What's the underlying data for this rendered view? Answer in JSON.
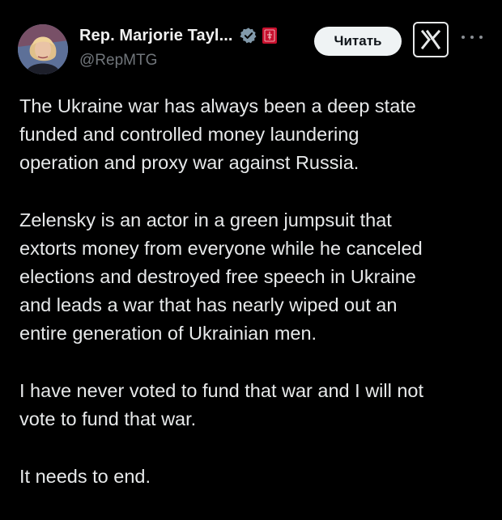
{
  "tweet": {
    "display_name": "Rep. Marjorie Tayl...",
    "handle": "@RepMTG",
    "follow_button_label": "Читать",
    "paragraphs": [
      [
        "The Ukraine war has always been a deep state",
        "funded and controlled money laundering",
        "operation and proxy war against Russia."
      ],
      [
        "Zelensky is an actor in a green jumpsuit that",
        "extorts money from everyone while he canceled",
        "elections and destroyed free speech in Ukraine",
        "and leads a war that has nearly wiped out an",
        "entire generation of Ukrainian men."
      ],
      [
        "I have never voted to fund that war and I will not",
        "vote to fund that war."
      ],
      [
        "It needs to end."
      ]
    ]
  },
  "icons": {
    "verified": "verified-badge-icon",
    "affiliation": "house-seal-icon",
    "logo": "x-logo-icon",
    "more": "more-dots-icon"
  },
  "colors": {
    "background": "#000000",
    "text": "#e7e9ea",
    "secondary_text": "#71767b",
    "verified_badge": "#829aab",
    "affiliation_badge": "#c8102e",
    "button_bg": "#eff3f4"
  }
}
